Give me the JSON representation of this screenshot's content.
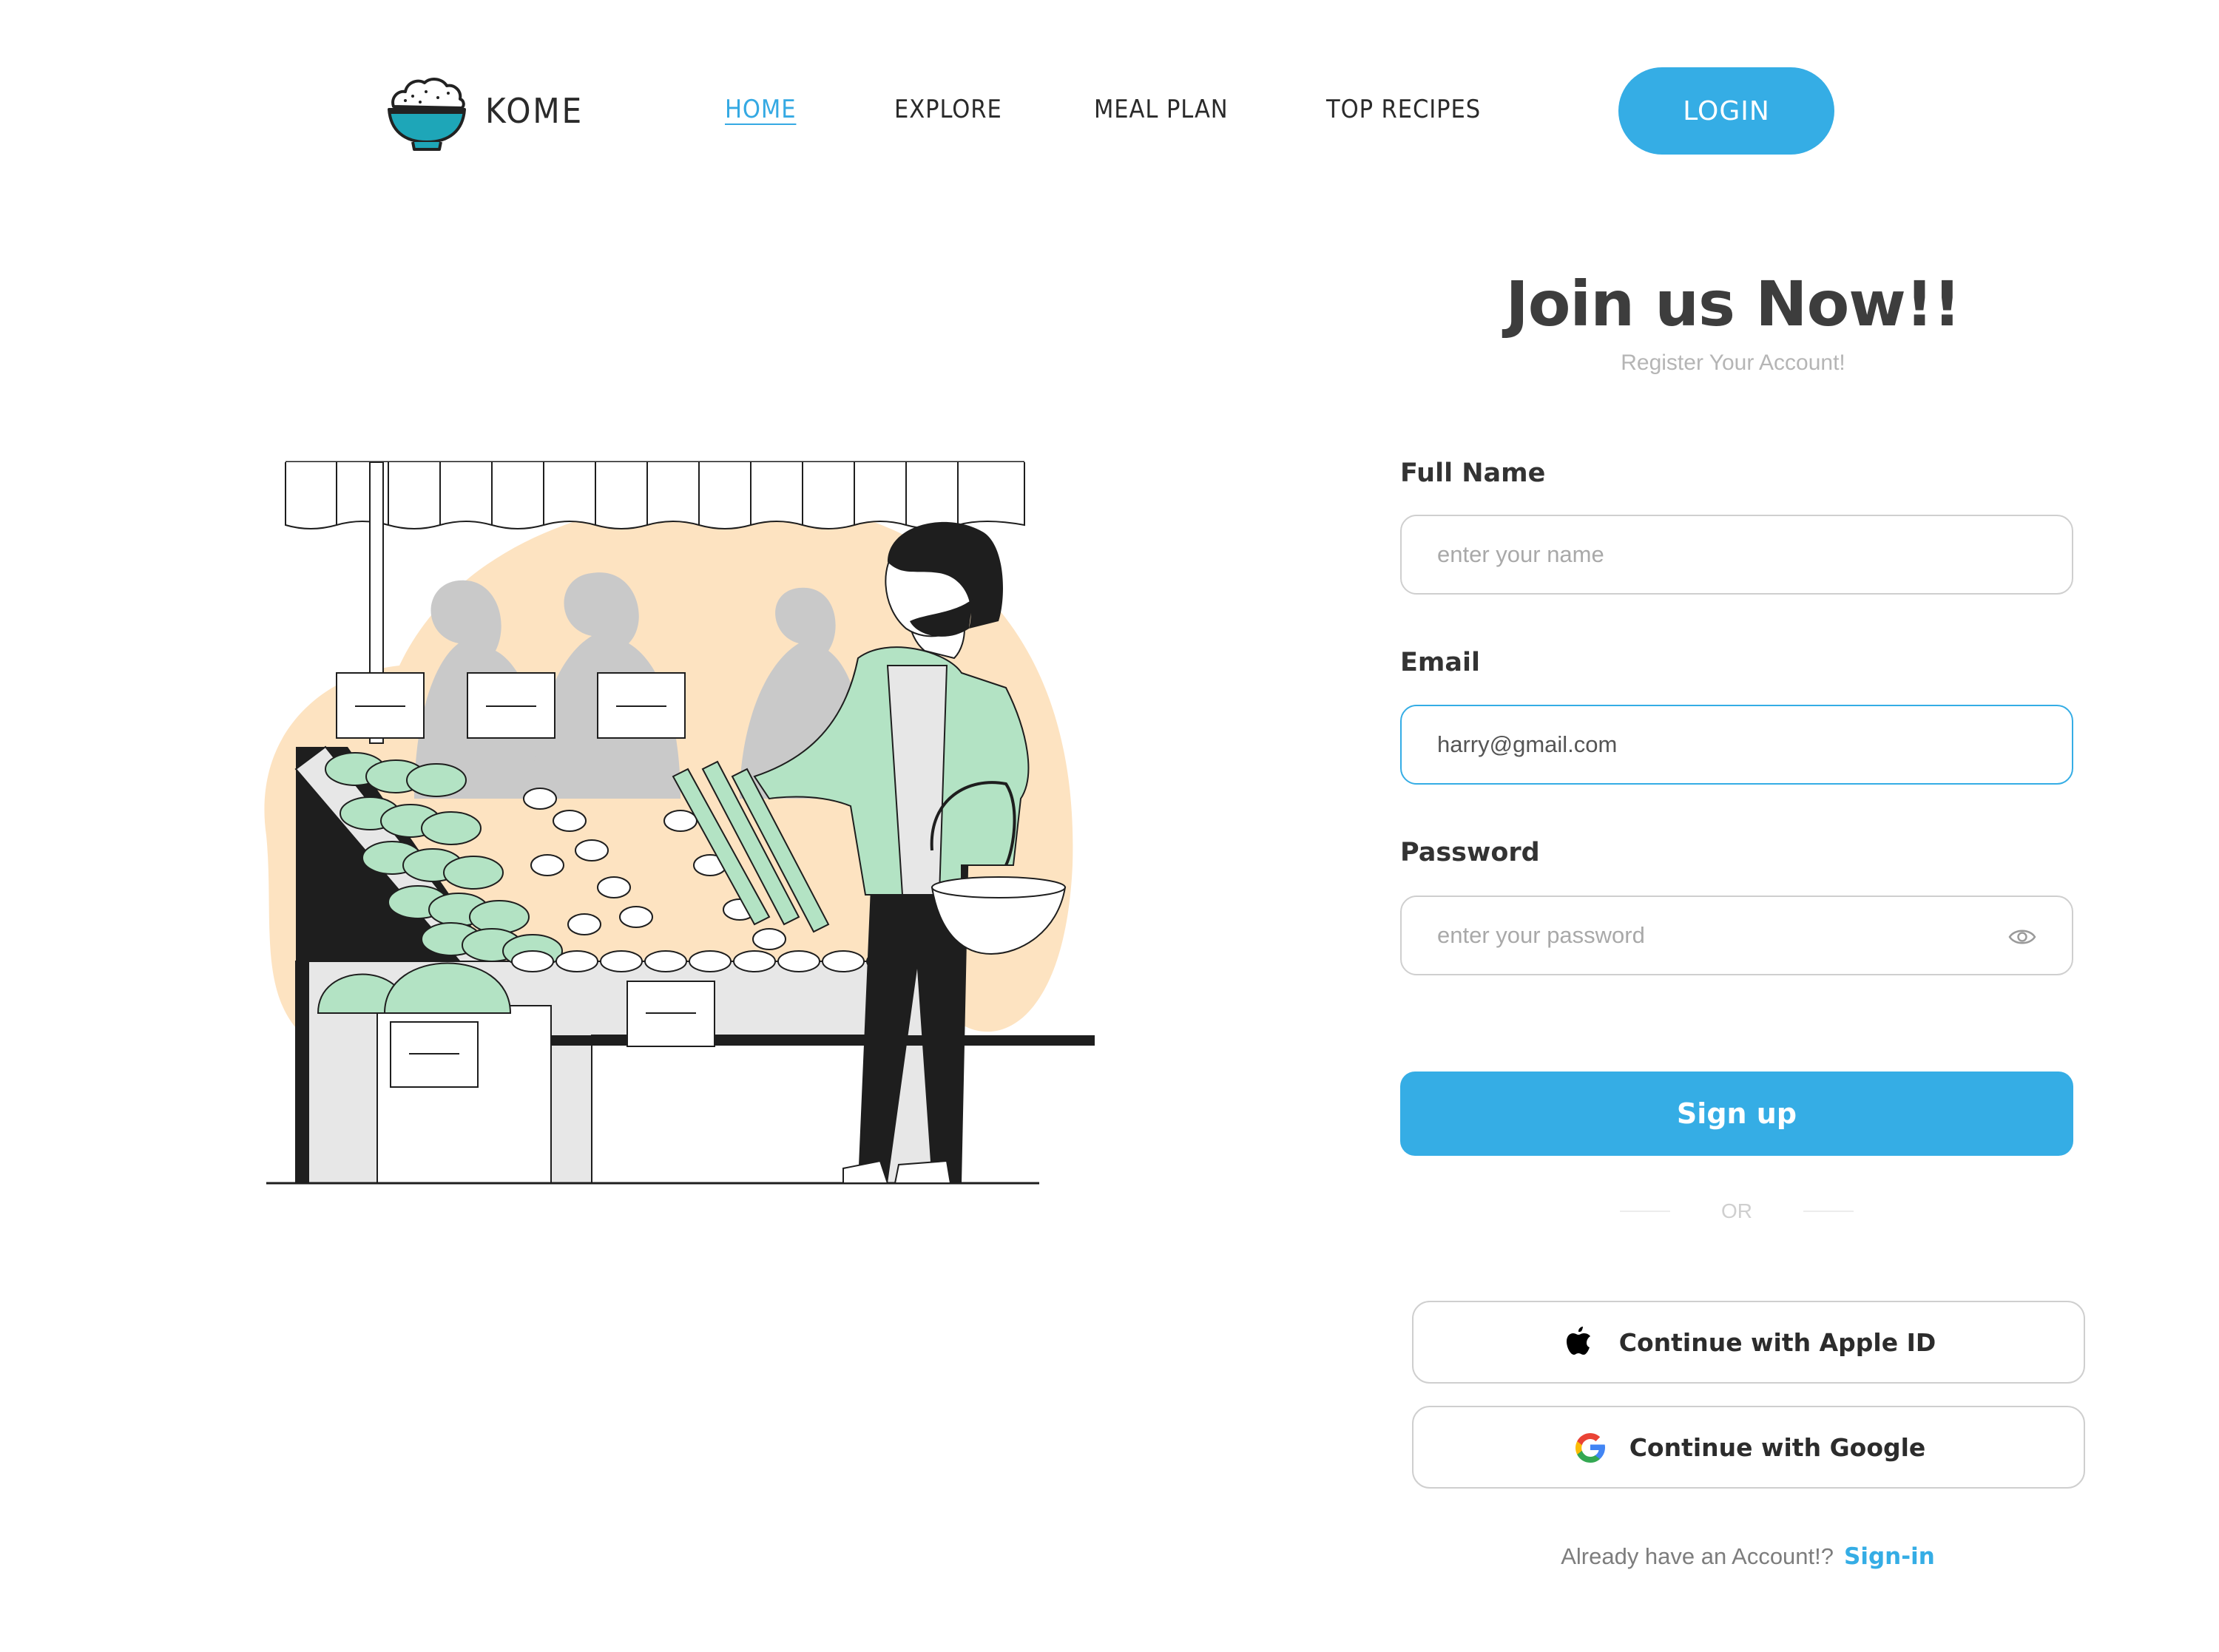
{
  "brand": {
    "name": "KOME",
    "accent": "#35ade5"
  },
  "nav": {
    "items": [
      {
        "label": "HOME",
        "active": true
      },
      {
        "label": "EXPLORE",
        "active": false
      },
      {
        "label": "MEAL PLAN",
        "active": false
      },
      {
        "label": "TOP RECIPES",
        "active": false
      }
    ],
    "login_label": "LOGIN"
  },
  "illustration": {
    "icon": "market-shopper-illustration"
  },
  "form": {
    "title": "Join us Now!!",
    "subtitle": "Register Your Account!",
    "full_name": {
      "label": "Full Name",
      "placeholder": "enter your name",
      "value": ""
    },
    "email": {
      "label": "Email",
      "placeholder": "",
      "value": "harry@gmail.com"
    },
    "password": {
      "label": "Password",
      "placeholder": "enter your password",
      "value": "",
      "icon": "eye-icon"
    },
    "submit_label": "Sign up",
    "divider_label": "OR",
    "apple_label": "Continue with Apple ID",
    "google_label": "Continue with Google",
    "footer_prompt": "Already have an Account!?",
    "footer_link": "Sign-in"
  }
}
